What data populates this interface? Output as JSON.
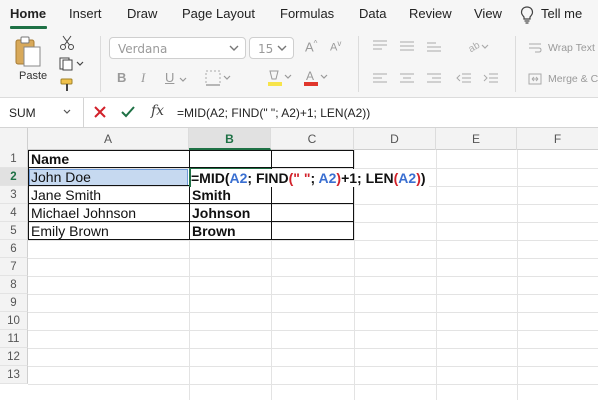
{
  "menu": {
    "items": [
      "Home",
      "Insert",
      "Draw",
      "Page Layout",
      "Formulas",
      "Data",
      "Review",
      "View"
    ],
    "tell_me": "Tell me"
  },
  "ribbon": {
    "paste_label": "Paste",
    "font_name": "Verdana",
    "font_size": "15",
    "wrap_text": "Wrap Text",
    "merge_center": "Merge & C"
  },
  "formula_bar": {
    "name_box": "SUM",
    "fx": "fx",
    "formula": "=MID(A2; FIND(\" \"; A2)+1; LEN(A2))"
  },
  "sheet": {
    "columns": [
      "A",
      "B",
      "C",
      "D",
      "E",
      "F"
    ],
    "selected_column": "B",
    "rows": [
      "1",
      "2",
      "3",
      "4",
      "5",
      "6",
      "7",
      "8",
      "9",
      "10",
      "11",
      "12",
      "13"
    ],
    "selected_row": "2",
    "cells": {
      "A1": "Name",
      "A2": "John Doe",
      "A3": "Jane Smith",
      "A4": "Michael Johnson",
      "A5": "Emily Brown",
      "B3": "Smith",
      "B4": "Johnson",
      "B5": "Brown"
    },
    "edit_formula_parts": [
      "=MID(",
      "A2",
      "; FIND",
      "(",
      "\" \"",
      "; ",
      "A2",
      ")",
      "+1; LEN",
      "(",
      "A2",
      ")",
      ")"
    ]
  },
  "colors": {
    "accent": "#1e7145",
    "ref_blue": "#3a6fd1",
    "ref_red": "#d2212a",
    "selection": "#c6d9f0"
  }
}
